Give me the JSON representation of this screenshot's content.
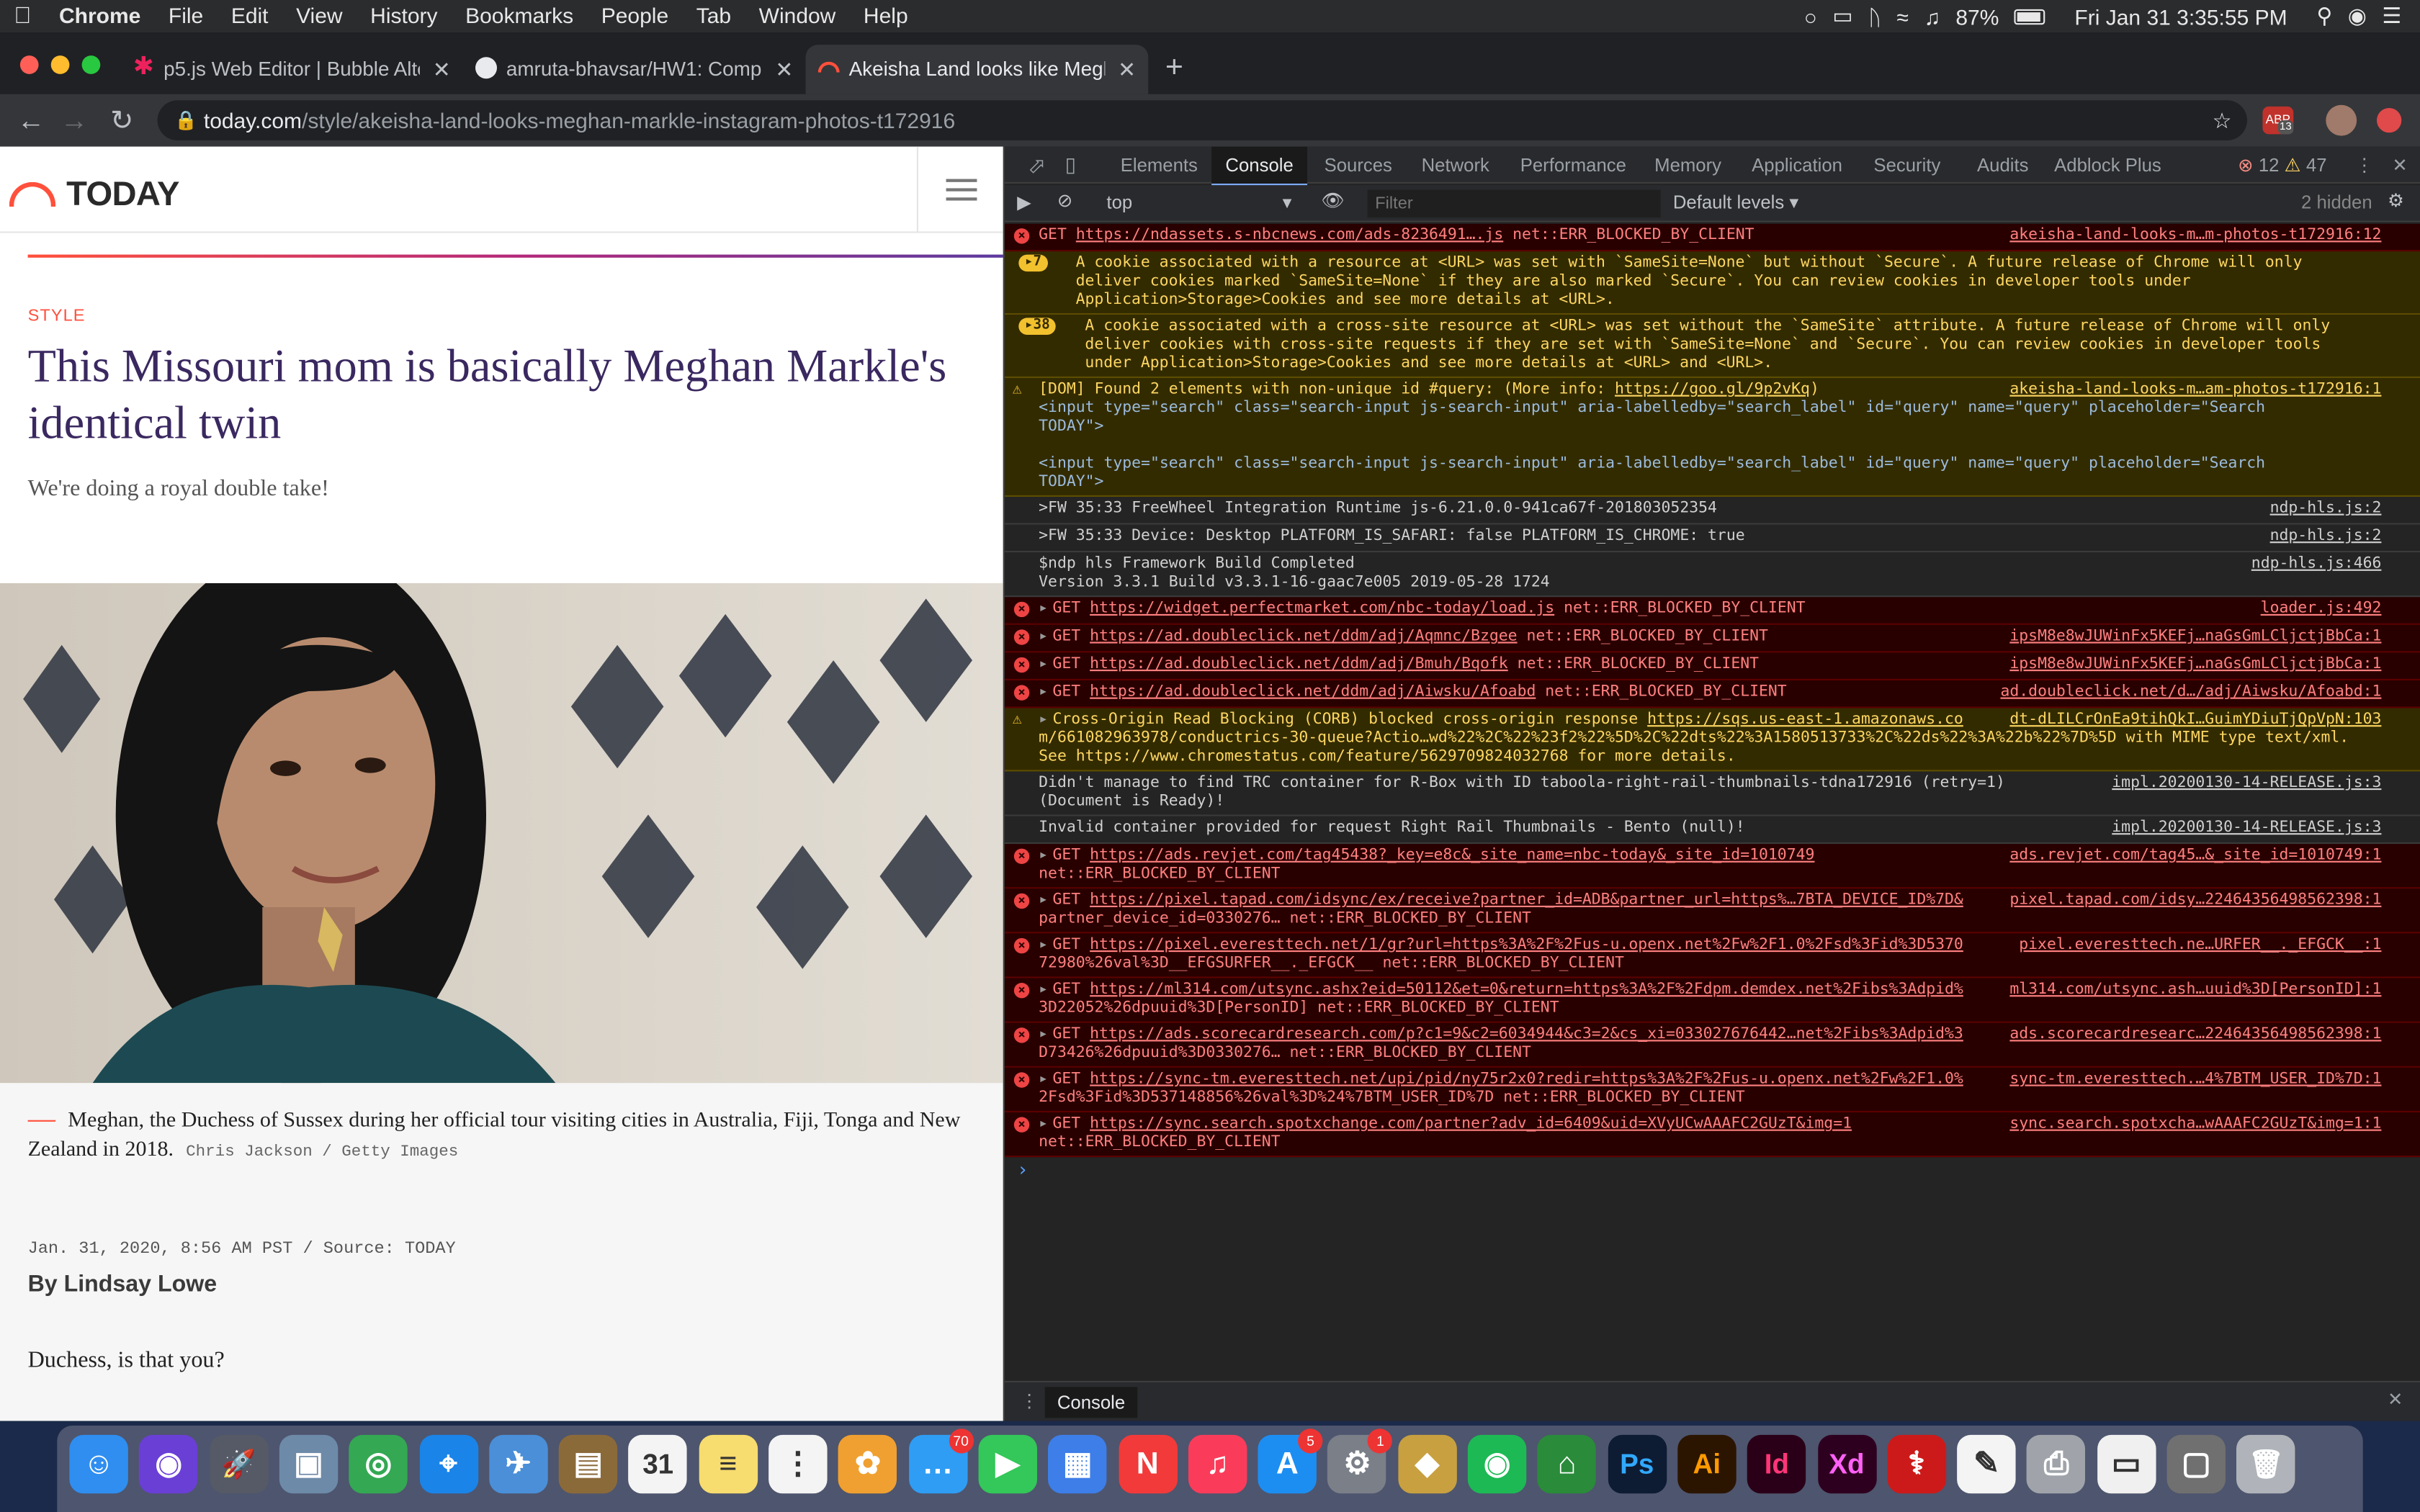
{
  "menubar": {
    "apple": "",
    "app": "Chrome",
    "items": [
      "File",
      "Edit",
      "View",
      "History",
      "Bookmarks",
      "People",
      "Tab",
      "Window",
      "Help"
    ],
    "battery": "87%",
    "datetime": "Fri Jan 31  3:35:55 PM"
  },
  "tabs": [
    {
      "title": "p5.js Web Editor | Bubble Alter",
      "favicon_color": "#ed225d"
    },
    {
      "title": "amruta-bhavsar/HW1: Comput",
      "favicon_color": "#e8eaed"
    },
    {
      "title": "Akeisha Land looks like Meghan",
      "favicon_color": "#ff503c"
    }
  ],
  "toolbar": {
    "url_host": "today.com",
    "url_path": "/style/akeisha-land-looks-meghan-markle-instagram-photos-t172916",
    "ext_badge": "13"
  },
  "page": {
    "logo": "TODAY",
    "eyebrow": "STYLE",
    "headline": "This Missouri mom is basically Meghan Markle's identical twin",
    "dek": "We're doing a royal double take!",
    "caption": "Meghan, the Duchess of Sussex during her official tour visiting cities in Australia, Fiji, Tonga and New Zealand in 2018.",
    "credit": "Chris Jackson / Getty Images",
    "dateline": "Jan. 31, 2020, 8:56 AM PST / Source: TODAY",
    "byline": "By Lindsay Lowe",
    "lede": "Duchess, is that you?"
  },
  "devtools": {
    "tabs": [
      "Elements",
      "Console",
      "Sources",
      "Network",
      "Performance",
      "Memory",
      "Application",
      "Security",
      "Audits",
      "Adblock Plus"
    ],
    "active_tab": "Console",
    "error_count": "12",
    "warning_count": "47",
    "context": "top",
    "filter_placeholder": "Filter",
    "levels": "Default levels ▾",
    "hidden": "2 hidden",
    "drawer_tab": "Console"
  },
  "console": [
    {
      "type": "err",
      "arrow": false,
      "pre": "GET ",
      "link": "https://ndassets.s-nbcnews.com/ads-8236491….js",
      "post": " net::ERR_BLOCKED_BY_CLIENT",
      "src": "akeisha-land-looks-m…m-photos-t172916:12",
      "lines": []
    },
    {
      "type": "warn",
      "badge": "7",
      "pre": "A cookie associated with a resource at <URL> was set with `SameSite=None` but without `Secure`. A future release of Chrome will only",
      "lines": [
        "deliver cookies marked `SameSite=None` if they are also marked `Secure`. You can review cookies in developer tools under",
        "Application>Storage>Cookies and see more details at <URL>."
      ]
    },
    {
      "type": "warn",
      "badge": "38",
      "pre": "A cookie associated with a cross-site resource at <URL> was set without the `SameSite` attribute. A future release of Chrome will only",
      "lines": [
        "deliver cookies with cross-site requests if they are set with `SameSite=None` and `Secure`. You can review cookies in developer tools",
        "under Application>Storage>Cookies and see more details at <URL> and <URL>."
      ]
    },
    {
      "type": "warn",
      "icon": true,
      "pre": "[DOM] Found 2 elements with non-unique id #query: (More info: ",
      "link": "https://goo.gl/9p2vKq",
      "post": ")",
      "src": "akeisha-land-looks-m…am-photos-t172916:1",
      "lines": [
        "  <input type=\"search\" class=\"search-input js-search-input\" aria-labelledby=\"search_label\" id=\"query\" name=\"query\" placeholder=\"Search",
        "  TODAY\">",
        "",
        "  <input type=\"search\" class=\"search-input js-search-input\" aria-labelledby=\"search_label\" id=\"query\" name=\"query\" placeholder=\"Search",
        "  TODAY\">"
      ]
    },
    {
      "type": "log",
      "pre": ">FW 35:33 FreeWheel Integration Runtime js-6.21.0.0-941ca67f-201803052354",
      "src": "ndp-hls.js:2",
      "lines": []
    },
    {
      "type": "log",
      "pre": ">FW 35:33 Device: Desktop PLATFORM_IS_SAFARI: false PLATFORM_IS_CHROME: true",
      "src": "ndp-hls.js:2",
      "lines": []
    },
    {
      "type": "log",
      "pre": "$ndp hls Framework Build Completed",
      "src": "ndp-hls.js:466",
      "lines": [
        "Version 3.3.1 Build v3.3.1-16-gaac7e005 2019-05-28 1724"
      ]
    },
    {
      "type": "err",
      "arrow": true,
      "pre": "GET ",
      "link": "https://widget.perfectmarket.com/nbc-today/load.js",
      "post": " net::ERR_BLOCKED_BY_CLIENT",
      "src": "loader.js:492",
      "lines": []
    },
    {
      "type": "err",
      "arrow": true,
      "pre": "GET ",
      "link": "https://ad.doubleclick.net/ddm/adj/Aqmnc/Bzgee",
      "post": " net::ERR_BLOCKED_BY_CLIENT",
      "src": "ipsM8e8wJUWinFx5KEFj…naGsGmLCljctjBbCa:1",
      "lines": []
    },
    {
      "type": "err",
      "arrow": true,
      "pre": "GET ",
      "link": "https://ad.doubleclick.net/ddm/adj/Bmuh/Bqofk",
      "post": " net::ERR_BLOCKED_BY_CLIENT",
      "src": "ipsM8e8wJUWinFx5KEFj…naGsGmLCljctjBbCa:1",
      "lines": []
    },
    {
      "type": "err",
      "arrow": true,
      "pre": "GET ",
      "link": "https://ad.doubleclick.net/ddm/adj/Aiwsku/Afoabd",
      "post": " net::ERR_BLOCKED_BY_CLIENT",
      "src": "ad.doubleclick.net/d…/adj/Aiwsku/Afoabd:1",
      "lines": []
    },
    {
      "type": "warn",
      "icon": true,
      "arrow": true,
      "pre": "Cross-Origin Read Blocking (CORB) blocked cross-origin response ",
      "link": "https://sqs.us-east-1.amazonaws.co",
      "post": "",
      "src": "dt-dLILCrOnEa9tihQkI…GuimYDiuTjQpVpN:103",
      "lines": [
        "m/661082963978/conductrics-30-queue?Actio…wd%22%2C%22%23f2%22%5D%2C%22dts%22%3A1580513733%2C%22ds%22%3A%22b%22%7D%5D with MIME type text/xml.",
        "See https://www.chromestatus.com/feature/5629709824032768 for more details."
      ]
    },
    {
      "type": "log",
      "pre": "Didn't manage to find TRC container for R-Box with ID taboola-right-rail-thumbnails-tdna172916 (retry=1)",
      "src": "impl.20200130-14-RELEASE.js:3",
      "lines": [
        "(Document is Ready)!"
      ]
    },
    {
      "type": "log",
      "pre": "Invalid container provided for request Right Rail Thumbnails - Bento (null)!",
      "src": "impl.20200130-14-RELEASE.js:3",
      "lines": []
    },
    {
      "type": "err",
      "arrow": true,
      "pre": "GET ",
      "link": "https://ads.revjet.com/tag45438?_key=e8c&_site_name=nbc-today&_site_id=1010749",
      "post": "",
      "src": "ads.revjet.com/tag45…&_site_id=1010749:1",
      "lines": [
        "net::ERR_BLOCKED_BY_CLIENT"
      ]
    },
    {
      "type": "err",
      "arrow": true,
      "pre": "GET ",
      "link": "https://pixel.tapad.com/idsync/ex/receive?partner_id=ADB&partner_url=https%…7BTA_DEVICE_ID%7D&",
      "post": "",
      "src": "pixel.tapad.com/idsy…22464356498562398:1",
      "lines": [
        "partner_device_id=0330276… net::ERR_BLOCKED_BY_CLIENT"
      ]
    },
    {
      "type": "err",
      "arrow": true,
      "pre": "GET ",
      "link": "https://pixel.everesttech.net/1/gr?url=https%3A%2F%2Fus-u.openx.net%2Fw%2F1.0%2Fsd%3Fid%3D5370",
      "post": "",
      "src": "pixel.everesttech.ne…URFER__._EFGCK__:1",
      "lines": [
        "72980%26val%3D__EFGSURFER__._EFGCK__ net::ERR_BLOCKED_BY_CLIENT"
      ]
    },
    {
      "type": "err",
      "arrow": true,
      "pre": "GET ",
      "link": "https://ml314.com/utsync.ashx?eid=50112&et=0&return=https%3A%2F%2Fdpm.demdex.net%2Fibs%3Adpid%",
      "post": "",
      "src": "ml314.com/utsync.ash…uuid%3D[PersonID]:1",
      "lines": [
        "3D22052%26dpuuid%3D[PersonID] net::ERR_BLOCKED_BY_CLIENT"
      ]
    },
    {
      "type": "err",
      "arrow": true,
      "pre": "GET ",
      "link": "https://ads.scorecardresearch.com/p?c1=9&c2=6034944&c3=2&cs_xi=033027676442…net%2Fibs%3Adpid%3",
      "post": "",
      "src": "ads.scorecardresearc…22464356498562398:1",
      "lines": [
        "D73426%26dpuuid%3D0330276… net::ERR_BLOCKED_BY_CLIENT"
      ]
    },
    {
      "type": "err",
      "arrow": true,
      "pre": "GET ",
      "link": "https://sync-tm.everesttech.net/upi/pid/ny75r2x0?redir=https%3A%2F%2Fus-u.openx.net%2Fw%2F1.0%",
      "post": "",
      "src": "sync-tm.everesttech.…4%7BTM_USER_ID%7D:1",
      "lines": [
        "2Fsd%3Fid%3D537148856%26val%3D%24%7BTM_USER_ID%7D net::ERR_BLOCKED_BY_CLIENT"
      ]
    },
    {
      "type": "err",
      "arrow": true,
      "pre": "GET ",
      "link": "https://sync.search.spotxchange.com/partner?adv_id=6409&uid=XVyUCwAAAFC2GUzT&img=1",
      "post": "",
      "src": "sync.search.spotxcha…wAAAFC2GUzT&img=1:1",
      "lines": [
        "net::ERR_BLOCKED_BY_CLIENT"
      ]
    }
  ],
  "dock": [
    {
      "name": "finder",
      "color": "#2f8ef0",
      "glyph": "☺"
    },
    {
      "name": "siri",
      "color": "#6a3fd6",
      "glyph": "◉"
    },
    {
      "name": "launchpad",
      "color": "#555a66",
      "glyph": "🚀"
    },
    {
      "name": "preview",
      "color": "#6d8aa8",
      "glyph": "▣"
    },
    {
      "name": "chrome",
      "color": "#34a853",
      "glyph": "◎"
    },
    {
      "name": "safari",
      "color": "#1a84e8",
      "glyph": "⌖"
    },
    {
      "name": "mail-app",
      "color": "#4a8fd8",
      "glyph": "✈"
    },
    {
      "name": "notebook",
      "color": "#8b6a3a",
      "glyph": "▤"
    },
    {
      "name": "calendar",
      "color": "#f4f4f4",
      "glyph": "31",
      "dark": true
    },
    {
      "name": "notes",
      "color": "#f7dc6f",
      "glyph": "≡",
      "dark": true
    },
    {
      "name": "reminders",
      "color": "#f4f4f4",
      "glyph": "⋮",
      "dark": true
    },
    {
      "name": "photos",
      "color": "#f0a030",
      "glyph": "✿"
    },
    {
      "name": "messages",
      "color": "#2f9df4",
      "glyph": "…",
      "badge": "70"
    },
    {
      "name": "facetime",
      "color": "#34c759",
      "glyph": "▶"
    },
    {
      "name": "keynote",
      "color": "#3d7ee8",
      "glyph": "▦"
    },
    {
      "name": "news",
      "color": "#f23a3a",
      "glyph": "N"
    },
    {
      "name": "music",
      "color": "#fa3c5a",
      "glyph": "♫"
    },
    {
      "name": "app-store",
      "color": "#1c8ef2",
      "glyph": "A",
      "badge": "5"
    },
    {
      "name": "system-preferences",
      "color": "#7a7f88",
      "glyph": "⚙",
      "badge": "1"
    },
    {
      "name": "cyberduck",
      "color": "#c8a040",
      "glyph": "◆"
    },
    {
      "name": "spotify",
      "color": "#1db954",
      "glyph": "◉"
    },
    {
      "name": "maps",
      "color": "#2a8b3a",
      "glyph": "⌂"
    },
    {
      "name": "photoshop",
      "color": "#0d1b33",
      "glyph": "Ps",
      "fg": "#31a8ff"
    },
    {
      "name": "illustrator",
      "color": "#2b1500",
      "glyph": "Ai",
      "fg": "#ff9a00"
    },
    {
      "name": "indesign",
      "color": "#2a0018",
      "glyph": "Id",
      "fg": "#ff3677"
    },
    {
      "name": "xd",
      "color": "#2e001f",
      "glyph": "Xd",
      "fg": "#ff61f6"
    },
    {
      "name": "acrobat",
      "color": "#cc1a1a",
      "glyph": "⚕"
    },
    {
      "name": "textedit",
      "color": "#f4f4f4",
      "glyph": "✎",
      "dark": true
    },
    {
      "name": "printer",
      "color": "#a0a4aa",
      "glyph": "⎙"
    },
    {
      "name": "document",
      "color": "#f0f0f0",
      "glyph": "▭",
      "dark": true
    },
    {
      "name": "screenshot",
      "color": "#707070",
      "glyph": "▢"
    },
    {
      "name": "trash",
      "color": "#b0b4ba",
      "glyph": "🗑"
    }
  ]
}
